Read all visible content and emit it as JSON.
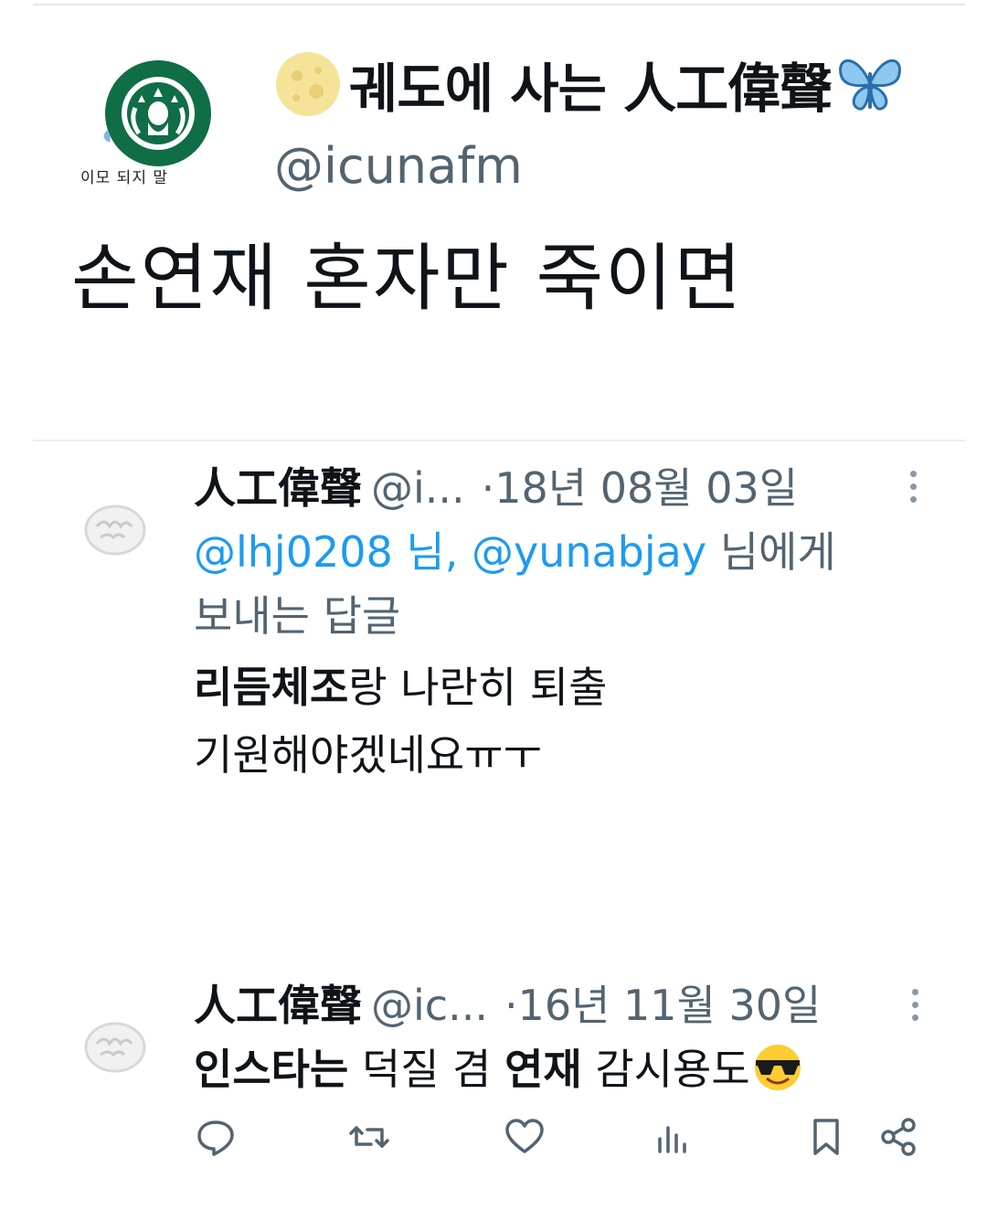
{
  "profile": {
    "display_name": "궤도에 사는 人工偉聲",
    "handle": "@icunafm",
    "avatar_caption": "이모 되지 말",
    "icons": {
      "left": "moon-icon",
      "right": "butterfly-icon",
      "avatar": "starbucks-logo"
    },
    "tweet_text": "손연재 혼자만 죽이면"
  },
  "replies": [
    {
      "name": "人工偉聲",
      "handle": "@i...",
      "date": "·18년 08월 03일",
      "reply_to_mention": "@lhj0208 님, @yunabjay",
      "reply_to_suffix": " 님에게",
      "reply_to_line2": "보내는 답글",
      "text_bold": "리듬체조",
      "text_rest": "랑 나란히 퇴출",
      "text_line2": "기원해야겠네요ㅠㅜ"
    },
    {
      "name": "人工偉聲",
      "handle": "@ic...",
      "date": "·16년 11월 30일",
      "seg1_bold": "인스타는",
      "seg2": " 덕질 겸 ",
      "seg3_bold": "연재",
      "seg4": " 감시용도",
      "emoji": "sunglasses-emoji"
    }
  ],
  "actions": [
    "reply-icon",
    "retweet-icon",
    "like-icon",
    "views-icon",
    "bookmark-icon",
    "share-icon"
  ],
  "colors": {
    "link": "#1d9bf0",
    "secondary": "#536471"
  }
}
